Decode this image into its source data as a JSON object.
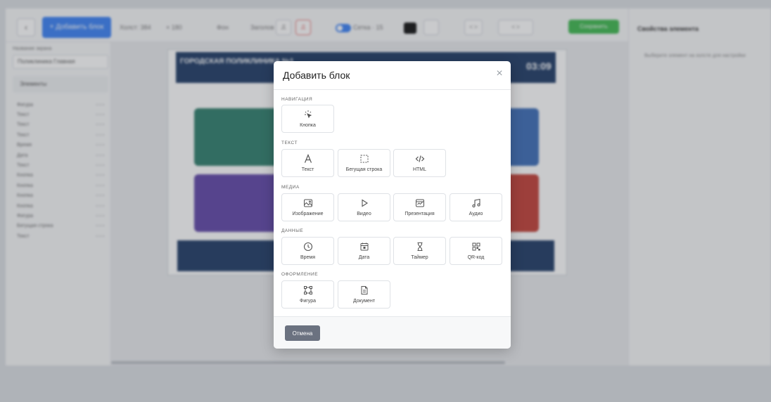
{
  "modal": {
    "title": "Добавить блок",
    "close_glyph": "×",
    "cancel_label": "Отмена",
    "sections": [
      {
        "label": "НАВИГАЦИЯ",
        "items": [
          {
            "label": "Кнопка",
            "icon": "pointer-click-icon"
          }
        ]
      },
      {
        "label": "ТЕКСТ",
        "items": [
          {
            "label": "Текст",
            "icon": "text-a-icon"
          },
          {
            "label": "Бегущая строка",
            "icon": "marquee-icon"
          },
          {
            "label": "HTML",
            "icon": "code-icon"
          }
        ]
      },
      {
        "label": "МЕДИА",
        "items": [
          {
            "label": "Изображение",
            "icon": "image-icon"
          },
          {
            "label": "Видео",
            "icon": "play-icon"
          },
          {
            "label": "Презентация",
            "icon": "presentation-icon"
          },
          {
            "label": "Аудио",
            "icon": "music-note-icon"
          }
        ]
      },
      {
        "label": "ДАННЫЕ",
        "items": [
          {
            "label": "Время",
            "icon": "clock-icon"
          },
          {
            "label": "Дата",
            "icon": "calendar-icon"
          },
          {
            "label": "Таймер",
            "icon": "hourglass-icon"
          },
          {
            "label": "QR-код",
            "icon": "qr-code-icon"
          }
        ]
      },
      {
        "label": "ОФОРМЛЕНИЕ",
        "items": [
          {
            "label": "Фигура",
            "icon": "shape-frame-icon"
          },
          {
            "label": "Документ",
            "icon": "document-icon"
          }
        ]
      }
    ]
  },
  "background": {
    "back_glyph": "‹",
    "add_block_label": "+ Добавить блок",
    "toolbar_texts": [
      "Холст: 384",
      "× 180",
      "Фон",
      "Заголов"
    ],
    "toolbar_boxes": [
      "Д",
      "Д",
      "< >",
      "< >"
    ],
    "toggle_label": "Сетка · 15",
    "save_label": "Сохранить",
    "sidebar": {
      "label": "Название экрана",
      "screen_name": "Поликлиника Главная",
      "elements_header": "Элементы",
      "items": [
        "Фигура",
        "Текст",
        "Текст",
        "Текст",
        "Время",
        "Дата",
        "Текст",
        "Кнопка",
        "Кнопка",
        "Кнопка",
        "Кнопка",
        "Фигура",
        "Бегущая строка",
        "Текст"
      ]
    },
    "slide_title": "ГОРОДСКАЯ ПОЛИКЛИНИКА №1",
    "slide_clock": "03:09",
    "properties_title": "Свойства элемента",
    "properties_hint": "Выберите элемент на холсте для настройки"
  },
  "colors": {
    "accent_blue": "#3b82f6",
    "save_green": "#3fb950",
    "cancel_gray": "#6b7280",
    "slide_navy": "#1f3b66"
  }
}
